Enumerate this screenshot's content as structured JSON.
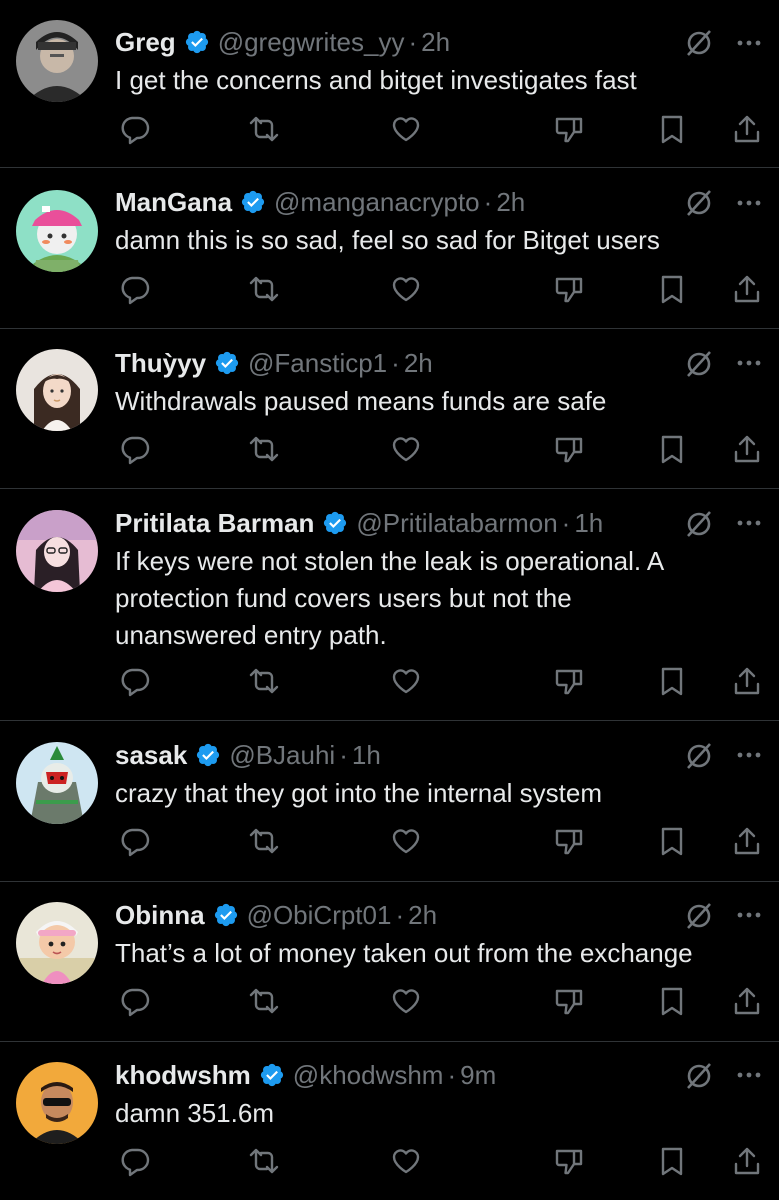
{
  "colors": {
    "background": "#000000",
    "text": "#e7e9ea",
    "muted": "#71767b",
    "verified": "#1d9bf0",
    "divider": "#2f3336"
  },
  "icons": {
    "verified": "verified-badge-icon",
    "grok": "grok-icon",
    "more": "more-options-icon",
    "reply": "reply-icon",
    "repost": "repost-icon",
    "like": "like-icon",
    "dislike": "dislike-icon",
    "bookmark": "bookmark-icon",
    "share": "share-icon"
  },
  "separator": "·",
  "tweets": [
    {
      "name": "Greg",
      "handle": "@gregwrites_yy",
      "time": "2h",
      "text": "I get the concerns and bitget investigates fast"
    },
    {
      "name": "ManGana",
      "handle": "@manganacrypto",
      "time": "2h",
      "text": "damn this is so sad, feel so sad for Bitget users"
    },
    {
      "name": "Thuỳyy",
      "handle": "@Fansticp1",
      "time": "2h",
      "text": "Withdrawals paused means funds are safe"
    },
    {
      "name": "Pritilata Barman",
      "handle": "@Pritilatabarmon",
      "time": "1h",
      "text": "If keys were not stolen the leak is operational. A\nprotection fund covers users but not the\nunanswered entry path."
    },
    {
      "name": "sasak",
      "handle": "@BJauhi",
      "time": "1h",
      "text": "crazy that they got into the internal system"
    },
    {
      "name": "Obinna",
      "handle": "@ObiCrpt01",
      "time": "2h",
      "text": "That’s a lot of money taken out from the exchange"
    },
    {
      "name": "khodwshm",
      "handle": "@khodwshm",
      "time": "9m",
      "text": "damn 351.6m"
    }
  ]
}
